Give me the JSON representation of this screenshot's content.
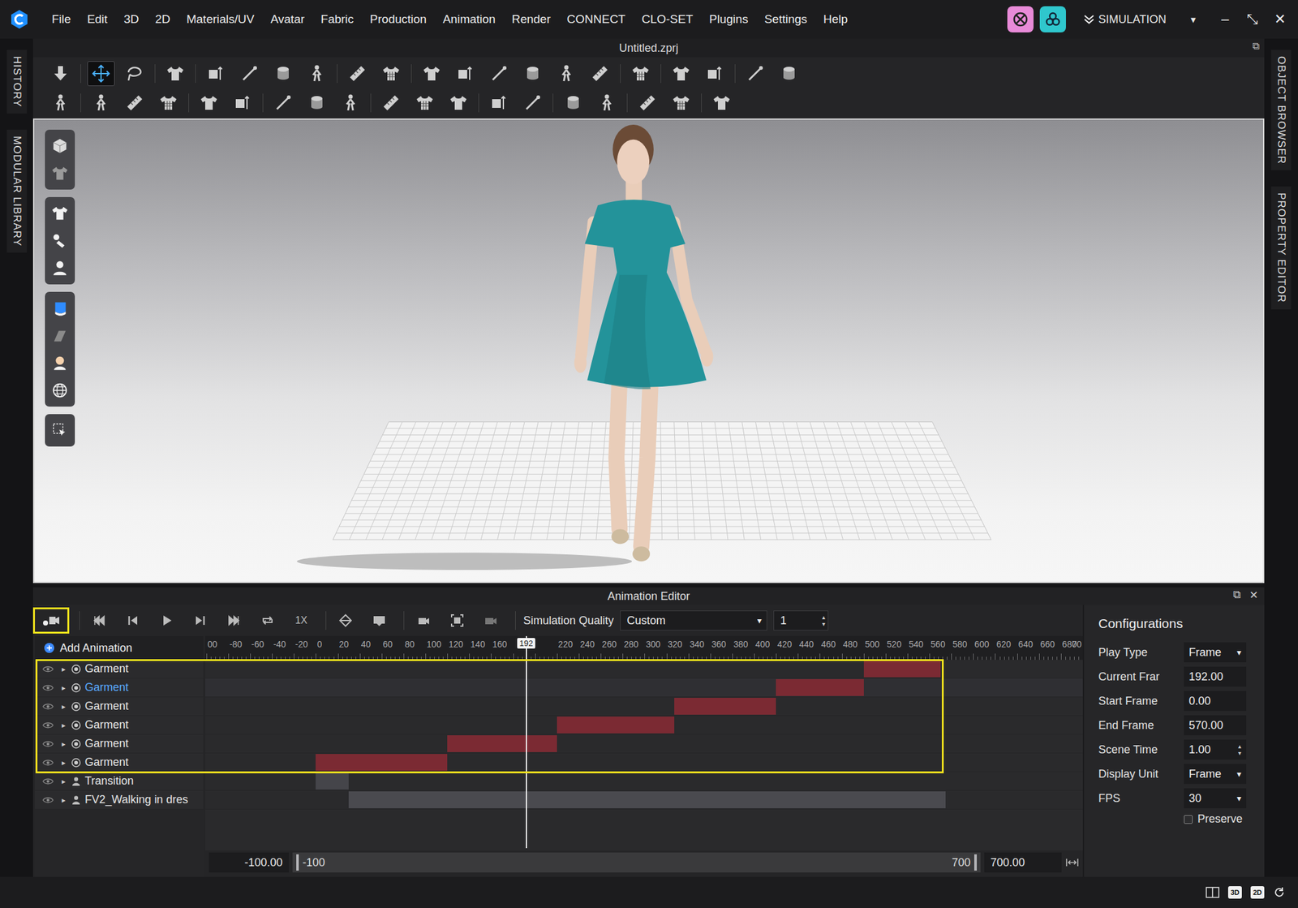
{
  "app": {
    "title": "Untitled.zprj",
    "restore": "⧉"
  },
  "menu": [
    "File",
    "Edit",
    "3D",
    "2D",
    "Materials/UV",
    "Avatar",
    "Fabric",
    "Production",
    "Animation",
    "Render",
    "CONNECT",
    "CLO-SET",
    "Plugins",
    "Settings",
    "Help"
  ],
  "header_right": {
    "apps": [
      {
        "color": "#e88ad8"
      },
      {
        "color": "#2fc7cd"
      }
    ],
    "mode": {
      "label": "SIMULATION",
      "arrow": "▾"
    },
    "window_controls": [
      "–",
      "⤡",
      "✕"
    ]
  },
  "side_tabs": {
    "left": [
      "HISTORY",
      "MODULAR LIBRARY"
    ],
    "right": [
      "OBJECT BROWSER",
      "PROPERTY EDITOR"
    ]
  },
  "toolbars": [
    [
      [
        false
      ],
      [
        true,
        false
      ],
      [
        false
      ],
      [
        false,
        false,
        false,
        false
      ],
      [
        false,
        false
      ],
      [
        false,
        false,
        false,
        false,
        false,
        false
      ],
      [
        false
      ],
      [
        false,
        false
      ],
      [
        false,
        false
      ]
    ],
    [
      [
        false
      ],
      [
        false,
        false,
        false
      ],
      [
        false,
        false
      ],
      [
        false,
        false,
        false
      ],
      [
        false,
        false,
        false
      ],
      [
        false,
        false
      ],
      [
        false,
        false
      ],
      [
        false,
        false
      ],
      [
        false
      ]
    ]
  ],
  "palette": [
    [
      false,
      false
    ],
    [
      false,
      false,
      false
    ],
    [
      false,
      false,
      false,
      false
    ],
    [
      false
    ]
  ],
  "animation_editor": {
    "title": "Animation Editor",
    "window_buttons": [
      "⧉",
      "✕"
    ],
    "record": {
      "highlighted": true
    },
    "speed": "1X",
    "simulation_quality": {
      "label": "Simulation Quality",
      "value": "Custom",
      "arrow": "▾"
    },
    "substeps": {
      "value": "1",
      "up": "▴",
      "down": "▾"
    },
    "add_animation": "Add Animation",
    "ruler": {
      "min": -101,
      "max": 700,
      "ticks": [
        {
          "frame": -100,
          "label": "00"
        },
        {
          "frame": -80,
          "label": "-80"
        },
        {
          "frame": -60,
          "label": "-60"
        },
        {
          "frame": -40,
          "label": "-40"
        },
        {
          "frame": -20,
          "label": "-20"
        },
        {
          "frame": 0,
          "label": "0"
        },
        {
          "frame": 20,
          "label": "20"
        },
        {
          "frame": 40,
          "label": "40"
        },
        {
          "frame": 60,
          "label": "60"
        },
        {
          "frame": 80,
          "label": "80"
        },
        {
          "frame": 100,
          "label": "100"
        },
        {
          "frame": 120,
          "label": "120"
        },
        {
          "frame": 140,
          "label": "140"
        },
        {
          "frame": 160,
          "label": "160"
        },
        {
          "frame": 220,
          "label": "220"
        },
        {
          "frame": 240,
          "label": "240"
        },
        {
          "frame": 260,
          "label": "260"
        },
        {
          "frame": 280,
          "label": "280"
        },
        {
          "frame": 300,
          "label": "300"
        },
        {
          "frame": 320,
          "label": "320"
        },
        {
          "frame": 340,
          "label": "340"
        },
        {
          "frame": 360,
          "label": "360"
        },
        {
          "frame": 380,
          "label": "380"
        },
        {
          "frame": 400,
          "label": "400"
        },
        {
          "frame": 420,
          "label": "420"
        },
        {
          "frame": 440,
          "label": "440"
        },
        {
          "frame": 460,
          "label": "460"
        },
        {
          "frame": 480,
          "label": "480"
        },
        {
          "frame": 500,
          "label": "500"
        },
        {
          "frame": 520,
          "label": "520"
        },
        {
          "frame": 540,
          "label": "540"
        },
        {
          "frame": 560,
          "label": "560"
        },
        {
          "frame": 580,
          "label": "580"
        },
        {
          "frame": 600,
          "label": "600"
        },
        {
          "frame": 620,
          "label": "620"
        },
        {
          "frame": 640,
          "label": "640"
        },
        {
          "frame": 660,
          "label": "660"
        },
        {
          "frame": 680,
          "label": "680"
        },
        {
          "frame": 700,
          "label": "70"
        }
      ]
    },
    "playhead": {
      "frame": 192,
      "label": "192"
    },
    "tracks": [
      {
        "name": "Garment",
        "kind": "garment",
        "expand": "▸",
        "visible": true,
        "selected": false,
        "highlighted": true,
        "start": 500,
        "end": 570,
        "color": "#7b2a33"
      },
      {
        "name": "Garment",
        "kind": "garment",
        "expand": "▸",
        "visible": true,
        "selected": true,
        "highlighted": true,
        "start": 420,
        "end": 500,
        "color": "#7b2a33"
      },
      {
        "name": "Garment",
        "kind": "garment",
        "expand": "▸",
        "visible": true,
        "selected": false,
        "highlighted": true,
        "start": 327,
        "end": 420,
        "color": "#7b2a33"
      },
      {
        "name": "Garment",
        "kind": "garment",
        "expand": "▸",
        "visible": true,
        "selected": false,
        "highlighted": true,
        "start": 220,
        "end": 327,
        "color": "#7b2a33"
      },
      {
        "name": "Garment",
        "kind": "garment",
        "expand": "▸",
        "visible": true,
        "selected": false,
        "highlighted": true,
        "start": 120,
        "end": 220,
        "color": "#7b2a33"
      },
      {
        "name": "Garment",
        "kind": "garment",
        "expand": "▸",
        "visible": true,
        "selected": false,
        "highlighted": true,
        "start": 0,
        "end": 120,
        "color": "#7b2a33"
      },
      {
        "name": "Transition",
        "kind": "avatar",
        "expand": "▸",
        "visible": true,
        "selected": false,
        "highlighted": false,
        "start": 0,
        "end": 30,
        "color": "#45454a"
      },
      {
        "name": "FV2_Walking in dres",
        "kind": "avatar",
        "expand": "▸",
        "visible": true,
        "selected": false,
        "highlighted": false,
        "start": 30,
        "end": 575,
        "color": "#4a4a4f"
      }
    ],
    "range": {
      "min_field": "-100.00",
      "start": "-100",
      "end": "700",
      "max_field": "700.00"
    },
    "config": {
      "title": "Configurations",
      "rows": [
        {
          "label": "Play Type",
          "value": "Frame",
          "kind": "dropdown",
          "arrow": "▾"
        },
        {
          "label": "Current Frar",
          "value": "192.00",
          "kind": "field"
        },
        {
          "label": "Start Frame",
          "value": "0.00",
          "kind": "field"
        },
        {
          "label": "End Frame",
          "value": "570.00",
          "kind": "field"
        },
        {
          "label": "Scene Time",
          "value": "1.00",
          "kind": "spinner",
          "up": "▴",
          "down": "▾"
        },
        {
          "label": "Display Unit",
          "value": "Frame",
          "kind": "dropdown",
          "arrow": "▾"
        },
        {
          "label": "FPS",
          "value": "30",
          "kind": "dropdown",
          "arrow": "▾"
        }
      ],
      "preserve": {
        "label": "Preserve",
        "checked": false
      }
    }
  },
  "status_bar": {
    "view_buttons": [
      "3D",
      "2D"
    ]
  }
}
